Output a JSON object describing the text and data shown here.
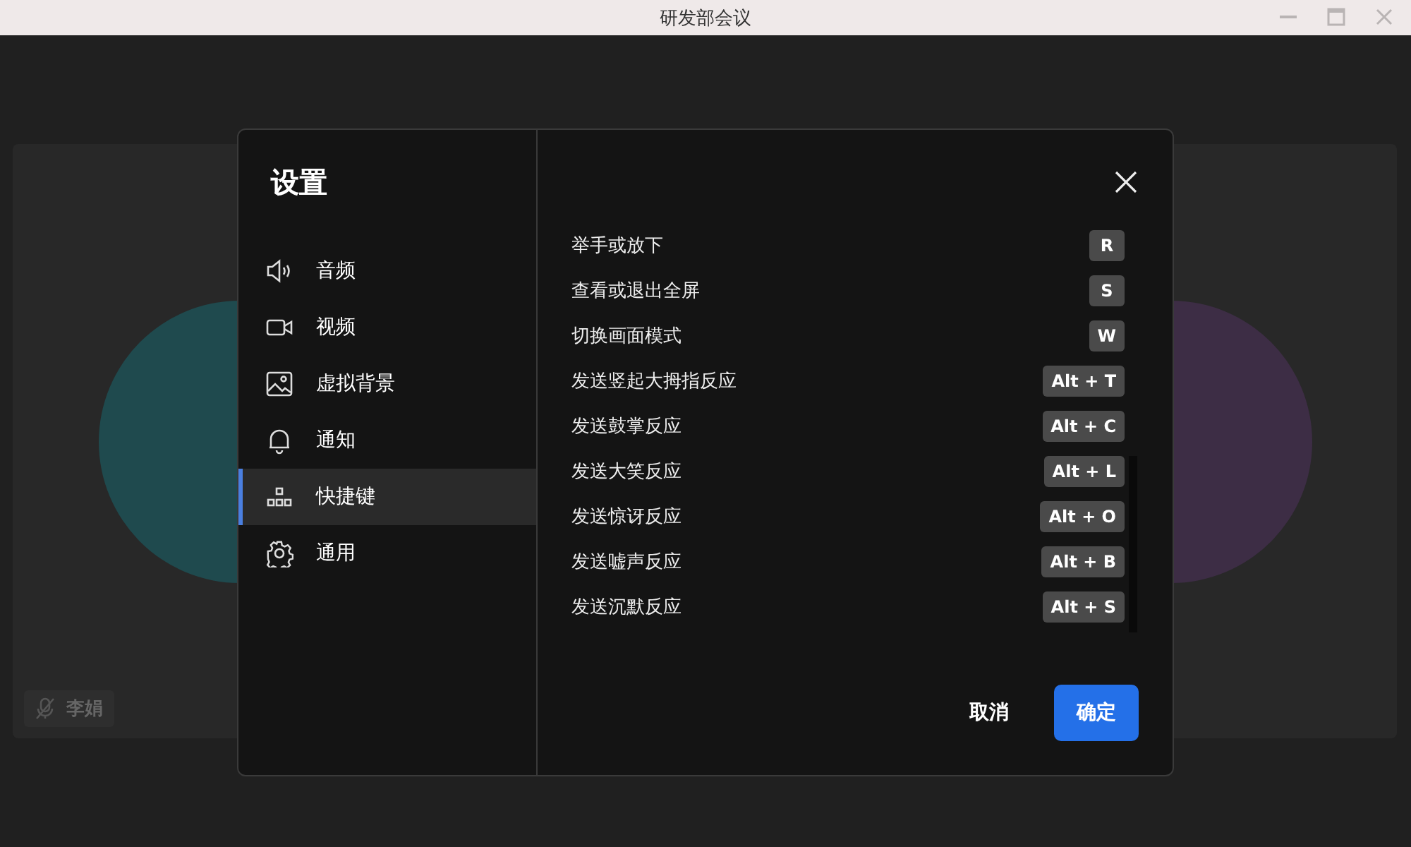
{
  "window": {
    "title": "研发部会议"
  },
  "participants": [
    {
      "name": "李娟",
      "muted": true,
      "color": "#1f4a4e"
    },
    {
      "color": "#3d2d45"
    }
  ],
  "dialog": {
    "title": "设置",
    "nav": [
      {
        "label": "音频",
        "kind": "audio",
        "selected": false
      },
      {
        "label": "视频",
        "kind": "video",
        "selected": false
      },
      {
        "label": "虚拟背景",
        "kind": "background",
        "selected": false
      },
      {
        "label": "通知",
        "kind": "notification",
        "selected": false
      },
      {
        "label": "快捷键",
        "kind": "shortcut",
        "selected": true
      },
      {
        "label": "通用",
        "kind": "general",
        "selected": false
      }
    ],
    "shortcuts": [
      {
        "action": "举手或放下",
        "keys": "R"
      },
      {
        "action": "查看或退出全屏",
        "keys": "S"
      },
      {
        "action": "切换画面模式",
        "keys": "W"
      },
      {
        "action": "发送竖起大拇指反应",
        "keys": "Alt + T"
      },
      {
        "action": "发送鼓掌反应",
        "keys": "Alt + C"
      },
      {
        "action": "发送大笑反应",
        "keys": "Alt + L"
      },
      {
        "action": "发送惊讶反应",
        "keys": "Alt + O"
      },
      {
        "action": "发送嘘声反应",
        "keys": "Alt + B"
      },
      {
        "action": "发送沉默反应",
        "keys": "Alt + S"
      }
    ],
    "cancel": "取消",
    "confirm": "确定"
  }
}
